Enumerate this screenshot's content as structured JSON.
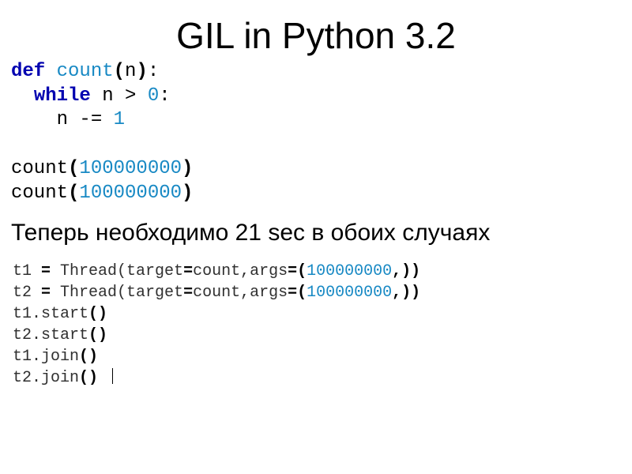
{
  "title": "GIL in Python 3.2",
  "code1": {
    "kw_def": "def",
    "fn": "count",
    "lp": "(",
    "param": "n",
    "rp": ")",
    "colon": ":",
    "kw_while": "while",
    "cond_var": "n",
    "gt": ">",
    "zero": "0",
    "colon2": ":",
    "body_var": "n",
    "minus_eq": "-=",
    "one": "1",
    "call_name": "count",
    "call_lp": "(",
    "big_num": "100000000",
    "call_rp": ")"
  },
  "body_text": "Теперь необходимо 21 sec в обоих случаях",
  "code2": {
    "l1a": "t1 ",
    "eq": "=",
    "l1b": " Thread(target",
    "l1c": "count,args",
    "l1d": "(",
    "big": "100000000",
    "l1e": ",))",
    "l2a": "t2 ",
    "l3": "t1.start",
    "l4": "t2.start",
    "l5": "t1.join",
    "l6": "t2.join",
    "pp": "()"
  }
}
